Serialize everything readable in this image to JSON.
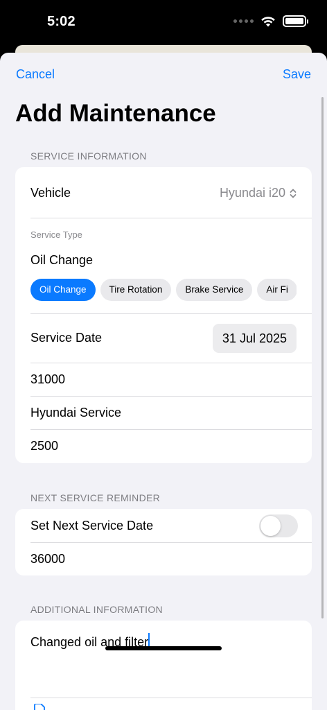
{
  "status_bar": {
    "time": "5:02"
  },
  "nav": {
    "cancel_label": "Cancel",
    "save_label": "Save",
    "title": "Add Maintenance"
  },
  "service_information": {
    "header": "SERVICE INFORMATION",
    "vehicle_label": "Vehicle",
    "vehicle_value": "Hyundai i20",
    "service_type_label": "Service Type",
    "service_type_value": "Oil Change",
    "service_type_options": [
      "Oil Change",
      "Tire Rotation",
      "Brake Service",
      "Air Fi"
    ],
    "selected_option": "Oil Change",
    "service_date_label": "Service Date",
    "service_date_value": "31 Jul 2025",
    "mileage_value": "31000",
    "service_provider_value": "Hyundai Service",
    "cost_value": "2500"
  },
  "next_service_reminder": {
    "header": "NEXT SERVICE REMINDER",
    "set_next_date_label": "Set Next Service Date",
    "set_next_date_enabled": false,
    "next_mileage_value": "36000"
  },
  "additional_information": {
    "header": "ADDITIONAL INFORMATION",
    "notes_value": "Changed oil and filter"
  },
  "colors": {
    "accent": "#0a7aff",
    "background": "#f2f2f7",
    "card": "#ffffff"
  }
}
